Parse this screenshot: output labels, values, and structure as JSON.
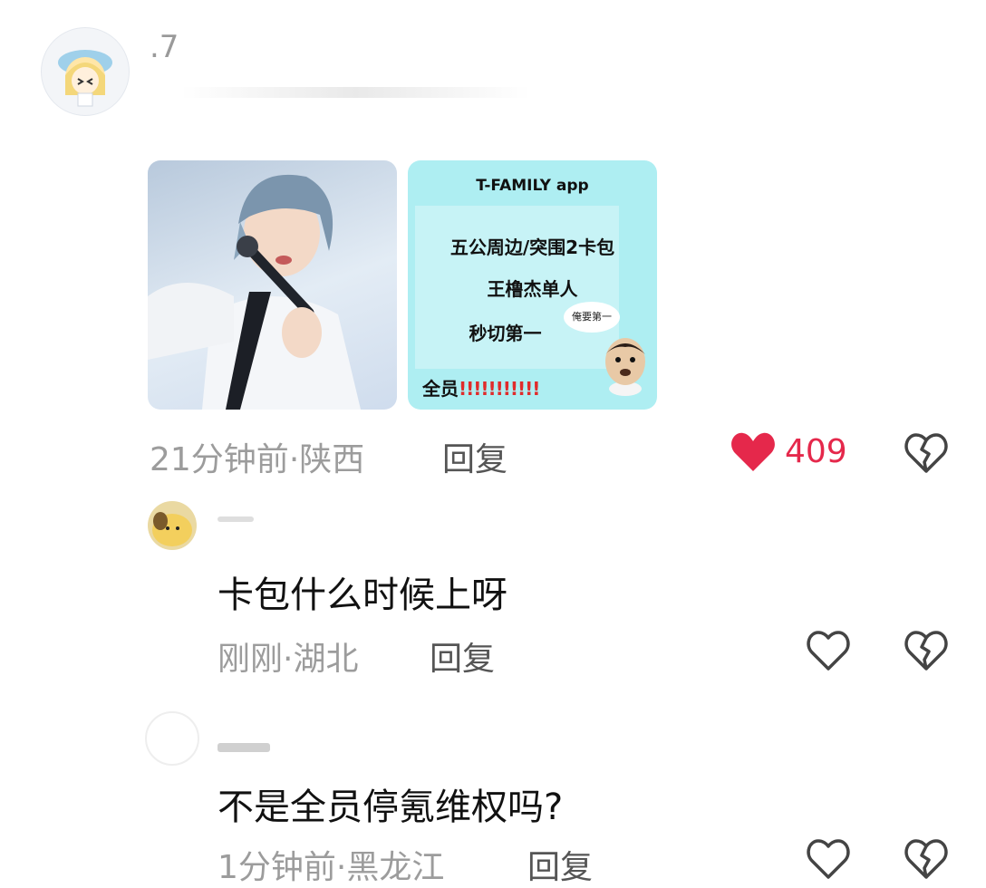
{
  "comments": [
    {
      "username": ".7",
      "time": "21分钟前",
      "location": "陕西",
      "reply_label": "回复",
      "like_count": "409",
      "liked": true
    },
    {
      "text": "卡包什么时候上呀",
      "time": "刚刚",
      "location": "湖北",
      "reply_label": "回复",
      "liked": false
    },
    {
      "text": "不是全员停氪维权吗?",
      "time": "1分钟前",
      "location": "黑龙江",
      "reply_label": "回复",
      "liked": false
    }
  ],
  "card": {
    "app": "T-FAMILY  app",
    "line1": "五公周边/突围2卡包",
    "line2": "王橹杰单人",
    "line3": "秒切第一",
    "bubble": "俺要第一",
    "footer": "全员",
    "marks": "!!!!!!!!!!!"
  },
  "separator": "·",
  "colors": {
    "like": "#e5284b",
    "meta": "#9c9c9c",
    "card_bg": "#aeeef2"
  }
}
